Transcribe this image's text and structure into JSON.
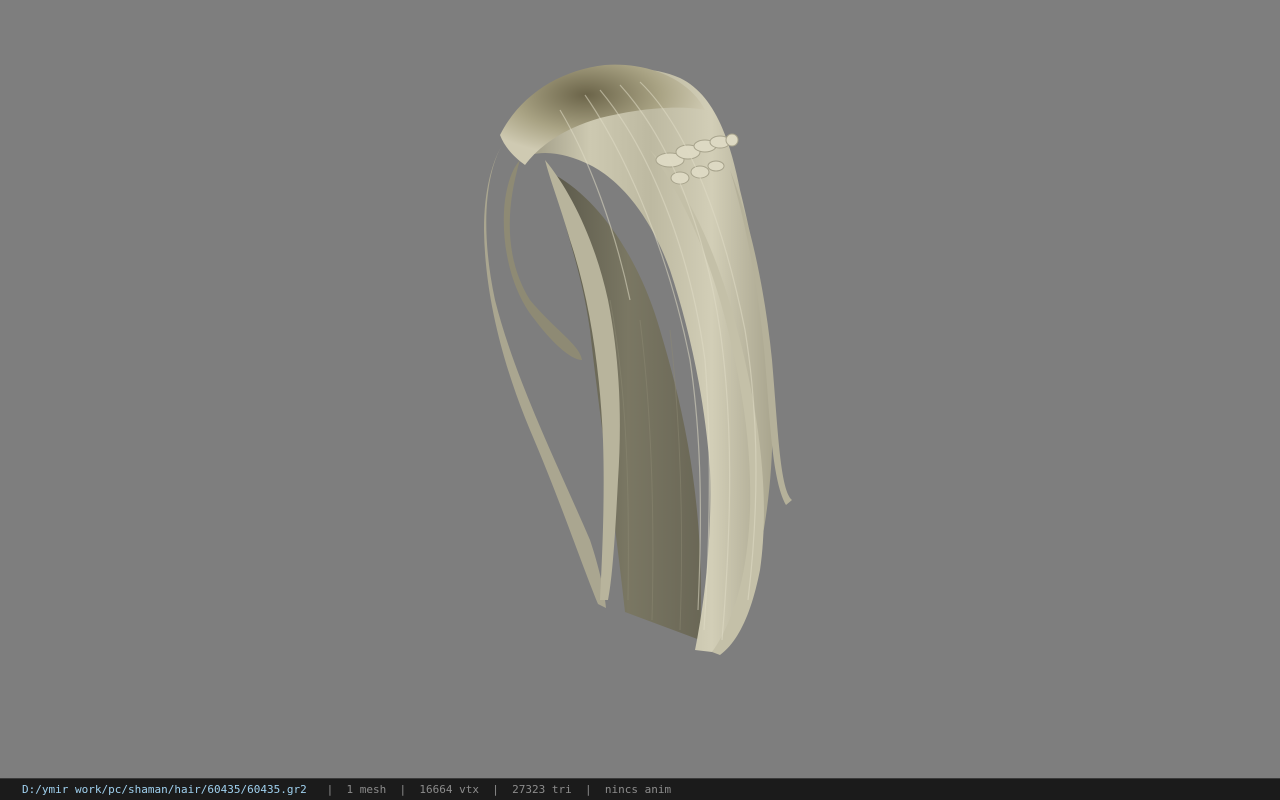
{
  "viewport": {
    "background_color": "#7e7e7e",
    "model_color": "#c9c5ad",
    "model_shadow_color": "#6d6a58",
    "model_icon": "hair-mesh-icon"
  },
  "statusbar": {
    "file_path": "D:/ymir work/pc/shaman/hair/60435/60435.gr2",
    "separator": "|",
    "mesh_count": "1 mesh",
    "vertex_count": "16664 vtx",
    "triangle_count": "27323 tri",
    "anim_status": "nincs anim",
    "path_color": "#9fd0ee",
    "text_color": "#8c8c8c",
    "background_color": "#1b1b1b"
  }
}
